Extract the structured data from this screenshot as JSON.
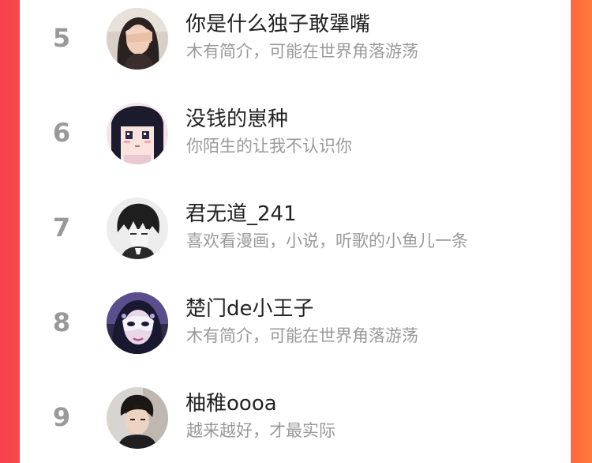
{
  "ranking": {
    "rows": [
      {
        "rank": "5",
        "name": "你是什么独子敢犟嘴",
        "bio": "木有简介，可能在世界角落游荡",
        "avatar": "user-avatar-photo-girl-covering-eyes"
      },
      {
        "rank": "6",
        "name": "没钱的崽种",
        "bio": "你陌生的让我不认识你",
        "avatar": "user-avatar-pixel-anime-girl"
      },
      {
        "rank": "7",
        "name": "君无道_241",
        "bio": "喜欢看漫画，小说，听歌的小鱼儿一条",
        "avatar": "user-avatar-sketch-anime-boy"
      },
      {
        "rank": "8",
        "name": "楚门de小王子",
        "bio": "木有简介，可能在世界角落游荡",
        "avatar": "user-avatar-masked-woman"
      },
      {
        "rank": "9",
        "name": "柚稚oooa",
        "bio": "越来越好，才最实际",
        "avatar": "user-avatar-photo-young-man"
      }
    ]
  },
  "colors": {
    "background_left": "#f5424d",
    "background_right": "#ff7a3a",
    "rank_text": "#999999",
    "name_text": "#222222",
    "bio_text": "#9a9a9a"
  }
}
